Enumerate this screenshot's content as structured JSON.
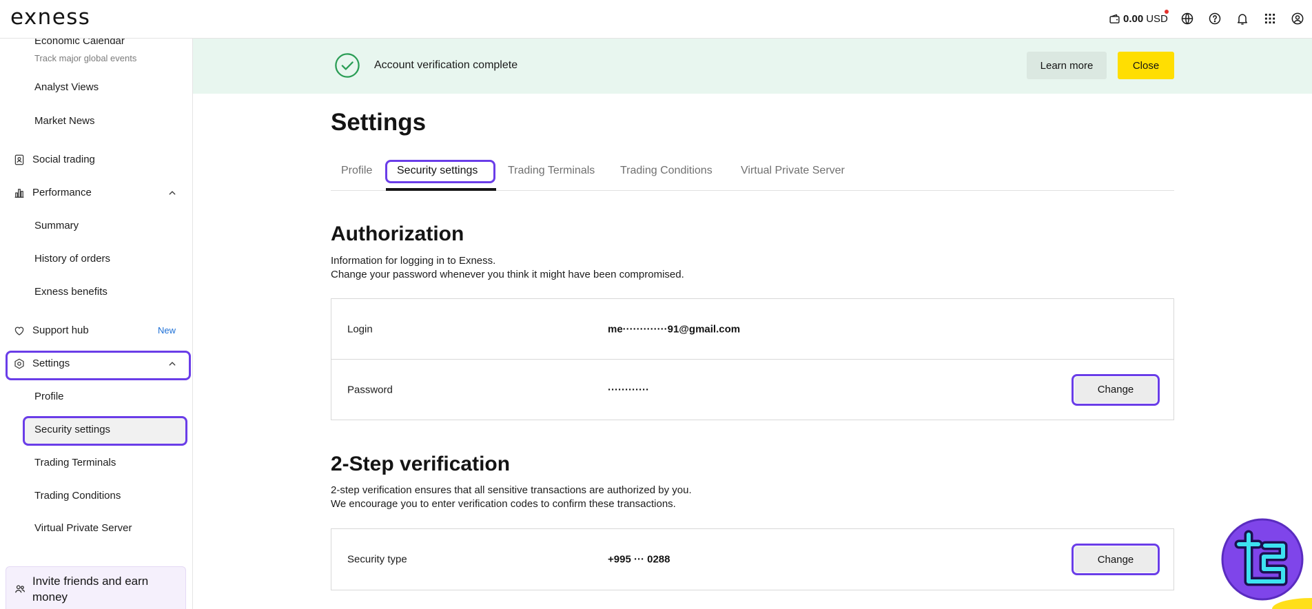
{
  "brand": {
    "logo_text": "exness"
  },
  "header": {
    "balance_amount": "0.00",
    "balance_currency": "USD",
    "icons": {
      "wallet": "wallet-icon",
      "language": "globe-icon",
      "help": "help-icon",
      "notifications": "bell-icon",
      "apps": "apps-grid-icon",
      "account": "user-icon"
    }
  },
  "sidebar": {
    "items": [
      {
        "label": "Economic Calendar",
        "description": "Track major global events"
      },
      {
        "label": "Analyst Views"
      },
      {
        "label": "Market News"
      },
      {
        "label": "Social trading",
        "icon": "social-trading-icon"
      },
      {
        "label": "Performance",
        "icon": "performance-icon",
        "expanded": true
      },
      {
        "label": "Summary"
      },
      {
        "label": "History of orders"
      },
      {
        "label": "Exness benefits"
      },
      {
        "label": "Support hub",
        "icon": "heart-icon",
        "badge": "New"
      },
      {
        "label": "Settings",
        "icon": "settings-icon",
        "expanded": true
      },
      {
        "label": "Profile"
      },
      {
        "label": "Security settings",
        "selected": true
      },
      {
        "label": "Trading Terminals"
      },
      {
        "label": "Trading Conditions"
      },
      {
        "label": "Virtual Private Server"
      }
    ],
    "invite": {
      "label": "Invite friends and earn money",
      "icon": "invite-friends-icon"
    }
  },
  "banner": {
    "icon": "check-circle-icon",
    "message": "Account verification complete",
    "learn_more_label": "Learn more",
    "close_label": "Close"
  },
  "page": {
    "title": "Settings",
    "tabs": [
      {
        "label": "Profile"
      },
      {
        "label": "Security settings",
        "active": true
      },
      {
        "label": "Trading Terminals"
      },
      {
        "label": "Trading Conditions"
      },
      {
        "label": "Virtual Private Server"
      }
    ]
  },
  "authorization": {
    "title": "Authorization",
    "description": [
      "Information for logging in to Exness.",
      "Change your password whenever you think it might have been compromised."
    ],
    "rows": [
      {
        "label": "Login",
        "value": "me·············91@gmail.com"
      },
      {
        "label": "Password",
        "value": "············",
        "action_label": "Change"
      }
    ]
  },
  "two_step": {
    "title": "2-Step verification",
    "description": [
      "2-step verification ensures that all sensitive transactions are authorized by you.",
      "We encourage you to enter verification codes to confirm these transactions."
    ],
    "rows": [
      {
        "label": "Security type",
        "value": "+995 ··· 0288",
        "action_label": "Change"
      }
    ]
  },
  "colors": {
    "highlight_outline": "#6a3de8",
    "banner_background": "#e8f6ef",
    "success_green": "#2a9d55",
    "close_button": "#ffde02",
    "notification_dot": "#e5322d",
    "badge_new": "#1c6fd6",
    "watermark_purple": "#7f45ea",
    "chat_button": "#ffdf1a"
  }
}
